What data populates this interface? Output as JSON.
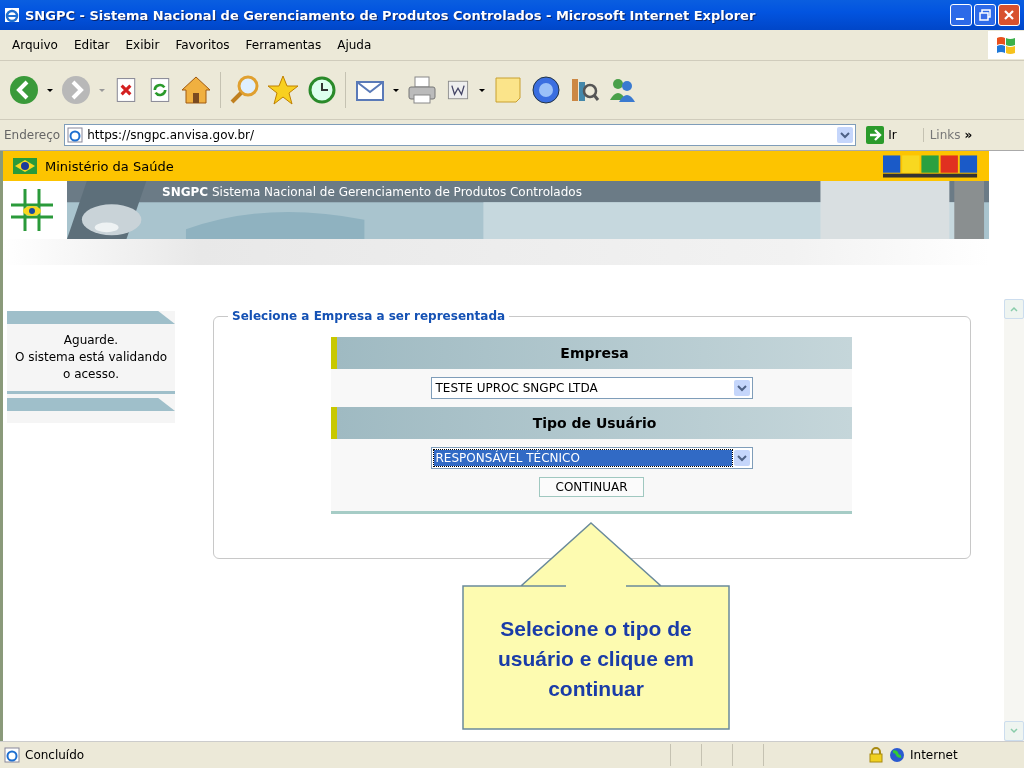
{
  "window": {
    "title": "SNGPC - Sistema Nacional de Gerenciamento de Produtos Controlados - Microsoft Internet Explorer"
  },
  "menu": [
    "Arquivo",
    "Editar",
    "Exibir",
    "Favoritos",
    "Ferramentas",
    "Ajuda"
  ],
  "address_bar": {
    "label": "Endereço",
    "url": "https://sngpc.anvisa.gov.br/",
    "go": "Ir",
    "links": "Links",
    "more": "»"
  },
  "page": {
    "ministry": "Ministério da Saúde",
    "banner_title": "**SNGPC** Sistema Nacional de Gerenciamento de Produtos Controlados",
    "sidebar_message": [
      "Aguarde.",
      "O sistema está validando",
      "o acesso."
    ],
    "form": {
      "legend": "Selecione a Empresa a ser representada",
      "fields": [
        {
          "heading": "Empresa",
          "value": "TESTE UPROC SNGPC LTDA",
          "selected": false
        },
        {
          "heading": "Tipo de Usuário",
          "value": "RESPONSÁVEL TÉCNICO",
          "selected": true
        }
      ],
      "button": "CONTINUAR"
    },
    "callout": "Selecione o tipo de usuário e clique em continuar"
  },
  "status_bar": {
    "text": "Concluído",
    "zone": "Internet"
  }
}
